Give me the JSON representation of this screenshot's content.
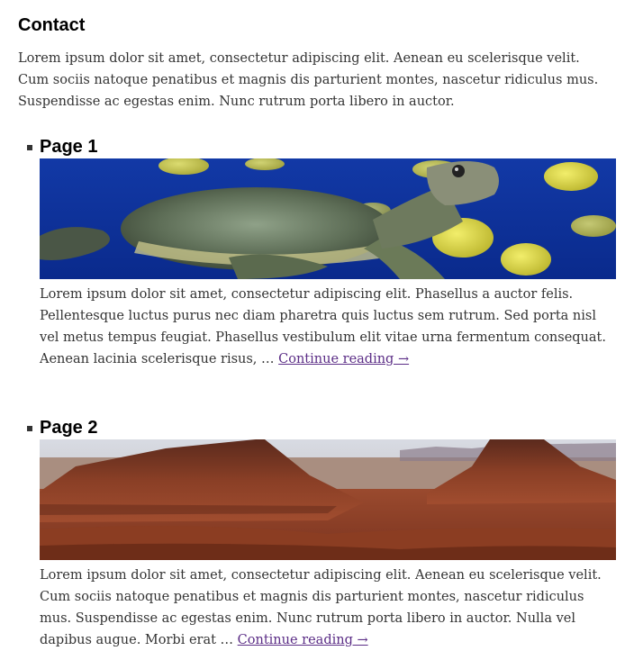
{
  "page": {
    "title": "Contact",
    "intro": "Lorem ipsum dolor sit amet, consectetur adipiscing elit. Aenean eu scelerisque velit. Cum sociis natoque penatibus et magnis dis parturient montes, nascetur ridiculus mus. Suspendisse ac egestas enim. Nunc rutrum porta libero in auctor."
  },
  "items": [
    {
      "heading": "Page 1",
      "image": "sea-turtle-image",
      "excerpt": "Lorem ipsum dolor sit amet, consectetur adipiscing elit. Phasellus a auctor felis. Pellentesque luctus purus nec diam pharetra quis luctus sem rutrum. Sed porta nisl vel metus tempus feugiat. Phasellus vestibulum elit vitae urna fermentum consequat. Aenean lacinia scelerisque risus, …",
      "link": "Continue reading →"
    },
    {
      "heading": "Page 2",
      "image": "desert-mesa-image",
      "excerpt": "Lorem ipsum dolor sit amet, consectetur adipiscing elit. Aenean eu scelerisque velit. Cum sociis natoque penatibus et magnis dis parturient montes, nascetur ridiculus mus. Suspendisse ac egestas enim. Nunc rutrum porta libero in auctor. Nulla vel dapibus augue. Morbi erat …",
      "link": "Continue reading →"
    }
  ],
  "colors": {
    "link": "#5b2d86",
    "text": "#333333",
    "heading": "#000000"
  }
}
